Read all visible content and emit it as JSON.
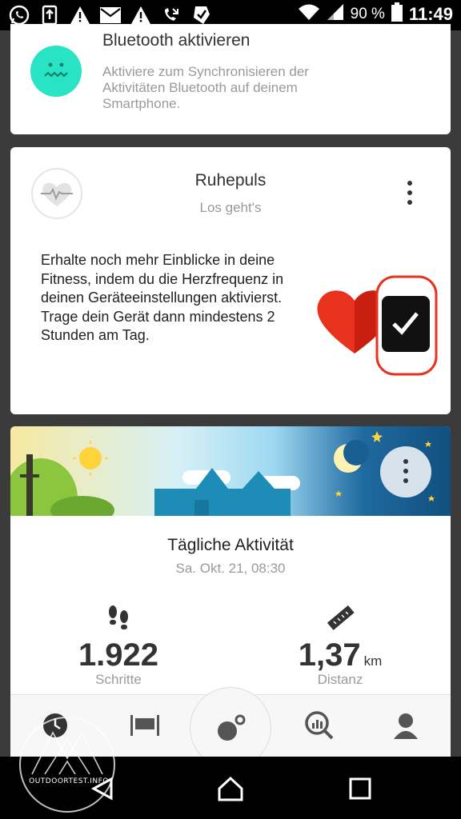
{
  "status_bar": {
    "left_icons": [
      "whatsapp-icon",
      "upload-icon",
      "warning-icon",
      "mail-icon",
      "warning-icon",
      "missed-call-icon",
      "notification-check-icon"
    ],
    "battery_percent": "90 %",
    "time": "11:49"
  },
  "bluetooth_card": {
    "title": "Bluetooth aktivieren",
    "description": "Aktiviere zum Synchronisieren der Aktivitäten Bluetooth auf deinem Smartphone."
  },
  "resting_pulse_card": {
    "title": "Ruhepuls",
    "subtitle": "Los geht's",
    "body": "Erhalte noch mehr Einblicke in deine Fitness, indem du die Herzfrequenz in deinen Geräteeinstellungen aktivierst. Trage dein Gerät dann mindestens 2 Stunden am Tag."
  },
  "daily_activity_card": {
    "title": "Tägliche Aktivität",
    "date": "Sa. Okt. 21, 08:30",
    "steps": {
      "value": "1.922",
      "label": "Schritte"
    },
    "distance": {
      "value": "1,37",
      "unit": "km",
      "label": "Distanz"
    }
  },
  "tab_bar": {
    "tabs": [
      "clock-icon",
      "sleep-icon",
      "activity-icon",
      "search-chart-icon",
      "profile-icon"
    ]
  },
  "watermark": {
    "text": "OUTDOORTEST.INFO"
  },
  "colors": {
    "accent_teal": "#28e3c4",
    "heart_red": "#e8321e",
    "bar_black": "#000000"
  }
}
